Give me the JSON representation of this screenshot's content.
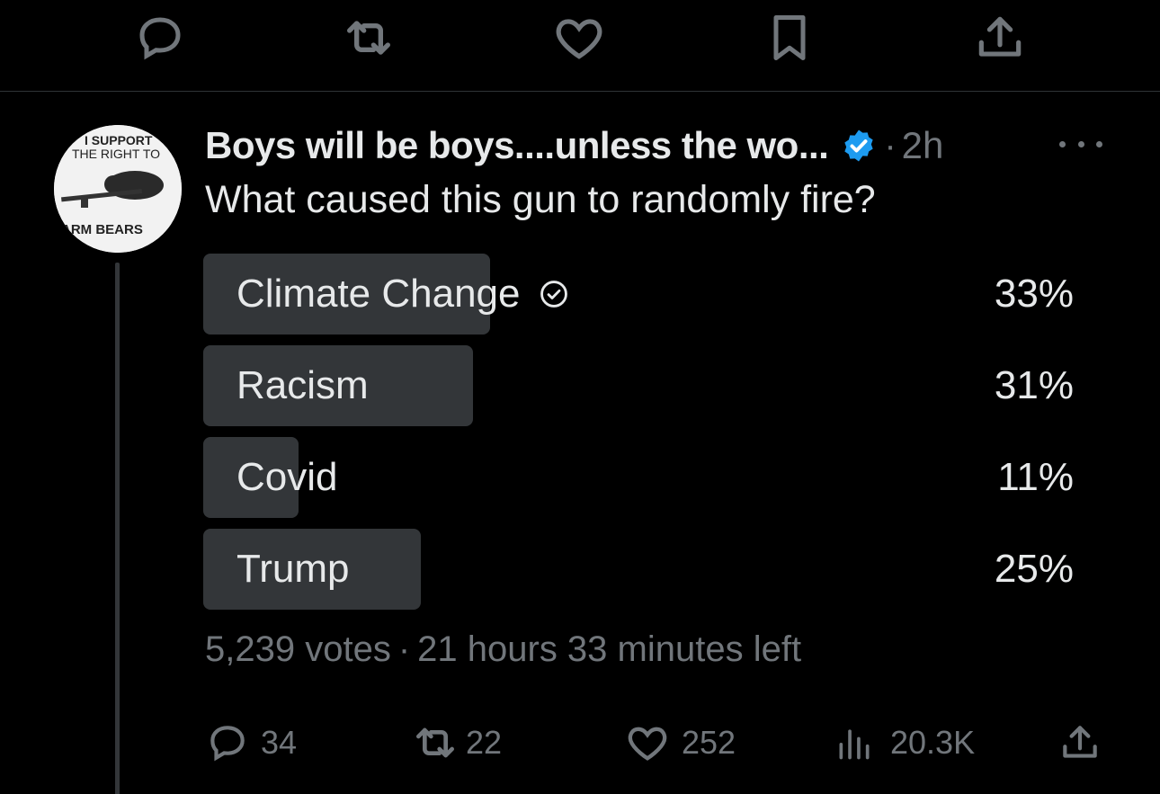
{
  "top_actions": [
    "reply-icon",
    "retweet-icon",
    "like-icon",
    "bookmark-icon",
    "share-icon"
  ],
  "tweet": {
    "avatar_text": [
      "I SUPPORT",
      "THE RIGHT TO",
      "ARM BEARS"
    ],
    "author_name": "Boys will be boys....unless the wo...",
    "separator": "·",
    "time": "2h",
    "text": "What caused this gun to randomly fire?",
    "colors": {
      "verified": "#1d9bf0",
      "bar": "#333639",
      "muted": "#71767b"
    }
  },
  "poll": {
    "options": [
      {
        "label": "Climate Change",
        "percent": "33%",
        "fraction": 0.33,
        "selected": true
      },
      {
        "label": "Racism",
        "percent": "31%",
        "fraction": 0.31,
        "selected": false
      },
      {
        "label": "Covid",
        "percent": "11%",
        "fraction": 0.11,
        "selected": false
      },
      {
        "label": "Trump",
        "percent": "25%",
        "fraction": 0.25,
        "selected": false
      }
    ],
    "votes": "5,239 votes",
    "meta_sep": "·",
    "time_left": "21 hours 33 minutes left"
  },
  "actions": {
    "replies": "34",
    "retweets": "22",
    "likes": "252",
    "views": "20.3K"
  }
}
